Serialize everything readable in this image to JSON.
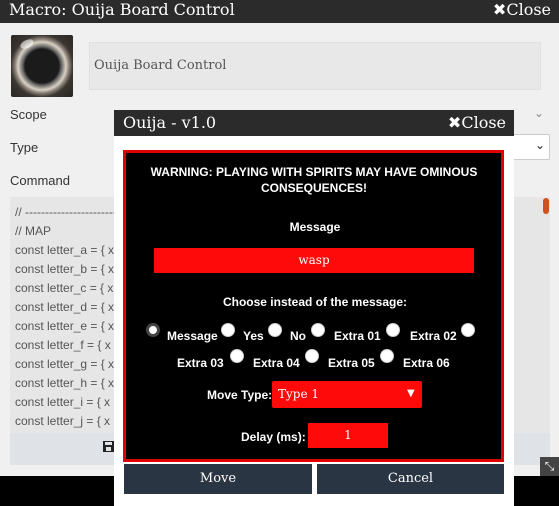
{
  "macro_window": {
    "title": "Macro: Ouija Board Control",
    "close_label": "Close",
    "name_value": "Ouija Board Control",
    "scope_label": "Scope",
    "type_label": "Type",
    "command_label": "Command",
    "code_lines": [
      "// ----------------------------",
      "// MAP",
      "const letter_a = { x",
      "const letter_b = { x",
      "const letter_c = { x",
      "const letter_d = { x",
      "const letter_e = { x",
      "const letter_f = { x",
      "const letter_g = { x",
      "const letter_h = { x",
      "const letter_i = { x",
      "const letter_j = { x"
    ],
    "icons": [
      "ouija-planchette-icon",
      "save-icon",
      "resize-icon",
      "chevron-down-icon",
      "close-icon"
    ]
  },
  "ouija": {
    "title": "Ouija - v1.0",
    "close_label": "Close",
    "warning": "WARNING: PLAYING WITH SPIRITS MAY HAVE OMINOUS CONSEQUENCES!",
    "message_label": "Message",
    "message_value": "wasp",
    "choose_label": "Choose instead of the message:",
    "options": [
      "Message",
      "Yes",
      "No",
      "Extra 01",
      "Extra 02",
      "Extra 03",
      "Extra 04",
      "Extra 05",
      "Extra 06"
    ],
    "selected_option": "Message",
    "move_type_label": "Move Type:",
    "move_type_value": "Type 1",
    "delay_label": "Delay (ms):",
    "delay_value": "1",
    "move_button": "Move",
    "cancel_button": "Cancel",
    "colors": {
      "accent_red": "#ff0a0a",
      "border_red": "#e10000",
      "button_bg": "#2a3544"
    }
  }
}
